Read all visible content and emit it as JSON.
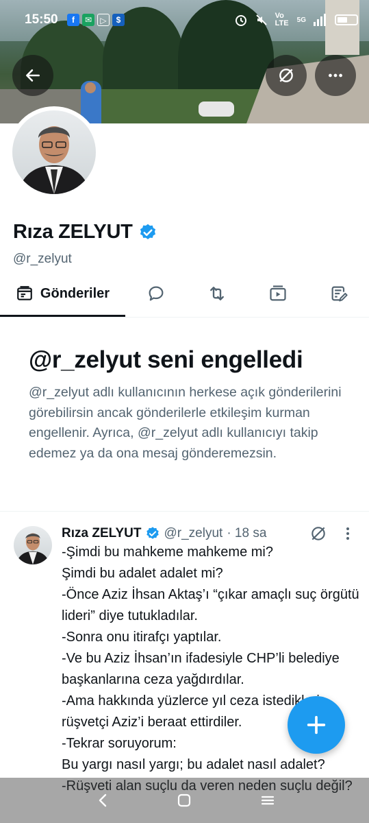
{
  "status_bar": {
    "time": "15:50",
    "network": "Vo LTE",
    "signal_label": "5G",
    "apps": [
      "facebook",
      "messages",
      "play",
      "wallet"
    ]
  },
  "header": {
    "back_icon": "arrow-left-icon",
    "grok_icon": "grok-icon",
    "more_icon": "more-icon"
  },
  "profile": {
    "name": "Rıza ZELYUT",
    "handle": "@r_zelyut",
    "verified": true
  },
  "tabs": [
    {
      "label": "Gönderiler",
      "icon": "posts-icon",
      "active": true
    },
    {
      "label": "",
      "icon": "replies-icon",
      "active": false
    },
    {
      "label": "",
      "icon": "reposts-icon",
      "active": false
    },
    {
      "label": "",
      "icon": "media-icon",
      "active": false
    },
    {
      "label": "",
      "icon": "articles-icon",
      "active": false
    }
  ],
  "blocked": {
    "title": "@r_zelyut seni engelledi",
    "body": "@r_zelyut adlı kullanıcının herkese açık gönderilerini görebilirsin ancak gönderilerle etkileşim kurman engellenir. Ayrıca, @r_zelyut adlı kullanıcıyı takip edemez ya da ona mesaj gönderemezsin."
  },
  "tweet": {
    "name": "Rıza ZELYUT",
    "handle": "@r_zelyut",
    "time": "· 18 sa",
    "text": "-Şimdi bu mahkeme mahkeme mi?\nŞimdi bu adalet adalet mi?\n-Önce Aziz İhsan Aktaş’ı “çıkar amaçlı suç örgütü lideri” diye tutukladılar.\n-Sonra onu itirafçı yaptılar.\n-Ve bu Aziz İhsan’ın ifadesiyle CHP’li belediye başkanlarına ceza yağdırdılar.\n-Ama hakkında yüzlerce yıl ceza istedikleri rüşvetçi Aziz’i beraat ettirdiler.\n-Tekrar soruyorum:\nBu yargı nasıl yargı; bu adalet nasıl adalet?\n-Rüşveti alan suçlu da veren neden suçlu değil?"
  },
  "colors": {
    "accent": "#1d9bf0",
    "text_primary": "#0f1419",
    "text_secondary": "#536471"
  }
}
